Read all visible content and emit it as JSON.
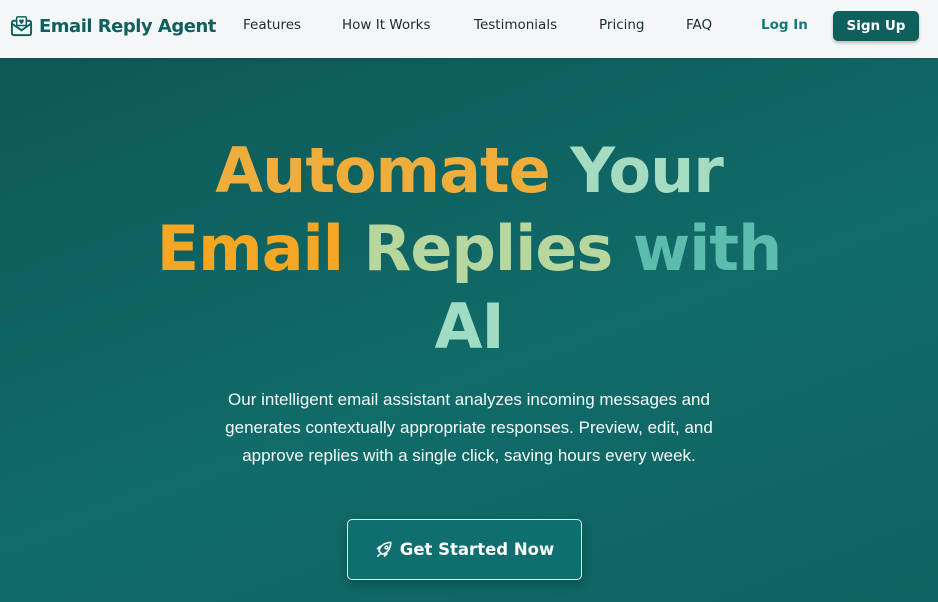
{
  "brand": {
    "name": "Email Reply Agent",
    "icon": "envelope-icon"
  },
  "nav": {
    "links": [
      "Features",
      "How It Works",
      "Testimonials",
      "Pricing",
      "FAQ"
    ],
    "login_label": "Log In",
    "signup_label": "Sign Up"
  },
  "hero": {
    "title_lines": [
      [
        "Automate",
        "Your"
      ],
      [
        "Email",
        "Replies",
        "with"
      ],
      [
        "AI"
      ]
    ],
    "subtitle_lines": [
      "Our intelligent email assistant analyzes incoming messages and",
      "generates contextually appropriate responses. Preview, edit, and",
      "approve replies with a single click, saving hours every week."
    ],
    "cta_label": "Get Started Now",
    "cta_icon": "rocket-icon"
  },
  "colors": {
    "brand_teal": "#0f5f5d",
    "link_teal": "#137a7a",
    "hero_bg": "#106b69",
    "title_gradient": [
      "#f5a623",
      "#c9cf8a",
      "#a4e0c8",
      "#5ec6b3"
    ]
  }
}
